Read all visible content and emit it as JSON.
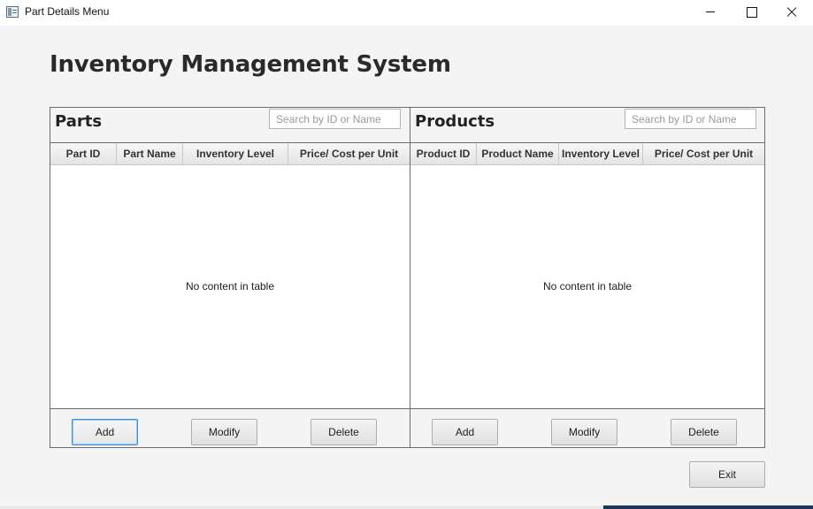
{
  "window": {
    "title": "Part Details Menu"
  },
  "main": {
    "title": "Inventory Management System"
  },
  "parts": {
    "title": "Parts",
    "search_placeholder": "Search by ID or Name",
    "columns": [
      "Part ID",
      "Part Name",
      "Inventory Level",
      "Price/ Cost per Unit"
    ],
    "empty_message": "No content in table",
    "add_label": "Add",
    "modify_label": "Modify",
    "delete_label": "Delete"
  },
  "products": {
    "title": "Products",
    "search_placeholder": "Search by ID or Name",
    "columns": [
      "Product ID",
      "Product Name",
      "Inventory Level",
      "Price/ Cost per Unit"
    ],
    "empty_message": "No content in table",
    "add_label": "Add",
    "modify_label": "Modify",
    "delete_label": "Delete"
  },
  "footer": {
    "exit_label": "Exit"
  },
  "icons": {
    "app": "app-window-icon",
    "minimize": "minimize-icon",
    "maximize": "maximize-icon",
    "close": "close-icon"
  },
  "colors": {
    "focus_accent": "#3b8ed8",
    "window_background": "#f4f4f4",
    "taskbar": "#1e3658"
  }
}
